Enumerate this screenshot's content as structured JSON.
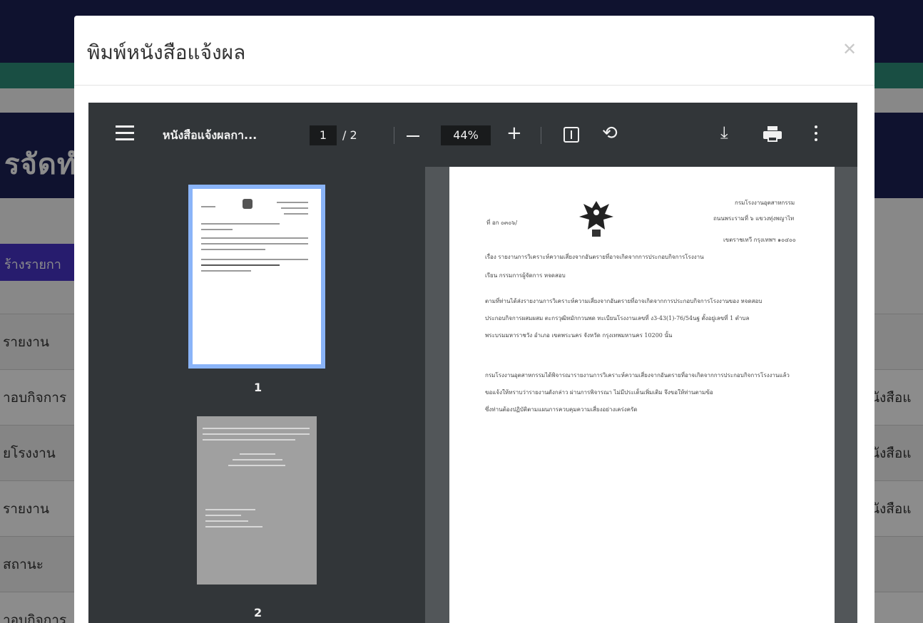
{
  "background": {
    "header_title": "รจัดทํ",
    "create_button": "ร้างรายกา",
    "rows": [
      {
        "label": "รายงาน",
        "right": ""
      },
      {
        "label": "าอบกิจการ",
        "right": "นังสือแ"
      },
      {
        "label": "ยโรงงาน",
        "right": "นังสือแ"
      },
      {
        "label": "รายงาน",
        "right": "นังสือแ"
      },
      {
        "label": "สถานะ",
        "right": ""
      },
      {
        "label": "าอบกิจการ",
        "right": ""
      }
    ]
  },
  "modal": {
    "title": "พิมพ์หนังสือแจ้งผล",
    "close_icon": "close-icon"
  },
  "viewer": {
    "doc_title": "หนังสือแจ้งผลกา...",
    "current_page": "1",
    "total_pages": "/ 2",
    "zoom": "44%",
    "icons": {
      "menu": "menu-icon",
      "zoom_out": "minus-icon",
      "zoom_in": "plus-icon",
      "fit": "fit-page-icon",
      "rotate": "rotate-icon",
      "download": "download-icon",
      "print": "print-icon",
      "more": "more-vert-icon"
    },
    "thumbnails": [
      {
        "label": "1",
        "selected": true
      },
      {
        "label": "2",
        "selected": false
      }
    ],
    "accent_color": "#8ab4f8"
  },
  "document": {
    "org_line1": "กรมโรงงานอุตสาหกรรม",
    "org_line2": "ถนนพระรามที่ ๖ แขวงทุ่งพญาไท",
    "org_line3": "เขตราชเทวี กรุงเทพฯ ๑๐๔๐๐",
    "ref_no": "ที่ อก ๐๓๐๖/",
    "subject": "เรื่อง รายงานการวิเคราะห์ความเสี่ยงจากอันตรายที่อาจเกิดจากการประกอบกิจการโรงงาน",
    "to": "เรียน กรรมการผู้จัดการ หจดสอบ",
    "para1_l1": "ตามที่ท่านได้ส่งรายงานการวิเคราะห์ความเสี่ยงจากอันตรายที่อาจเกิดจากการประกอบกิจการโรงงานของ หจดสอบ",
    "para1_l2": "ประกอบกิจการผสมผสม ตะกรวุฒิหมักกวนพด ทะเบียนโรงงานเลขที่ ง3-43(1)-76/54นฐ ตั้งอยู่เลขที่ 1 ตำบล",
    "para1_l3": "พระบรมมหาราชวัง อำเภอ เขตพระนคร จังหวัด กรุงเทพมหานคร 10200 นั้น",
    "para2_l1": "กรมโรงงานอุตสาหกรรมได้พิจารณารายงานการวิเคราะห์ความเสี่ยงจากอันตรายที่อาจเกิดจากการประกอบกิจการโรงงานแล้ว",
    "para2_l2": "ขอแจ้งให้ทราบว่ารายงานดังกล่าว ผ่านการพิจารณา ไม่มีประเด็นเพิ่มเติม จึงขอให้ท่านตามข้อ",
    "para2_l3": "ซึ่งท่านต้องปฏิบัติตามแผนการควบคุมความเสี่ยงอย่างเคร่งครัด"
  }
}
